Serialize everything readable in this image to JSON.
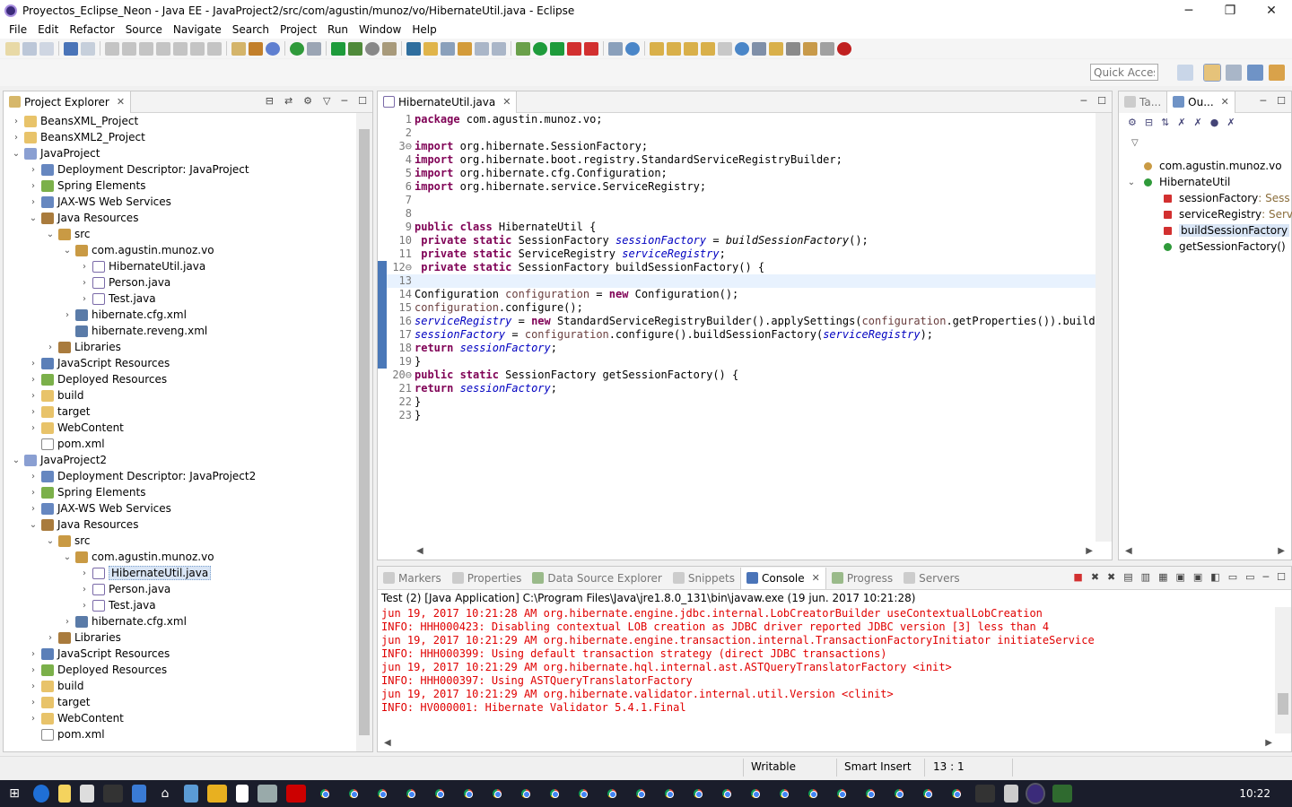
{
  "window": {
    "title": "Proyectos_Eclipse_Neon - Java EE - JavaProject2/src/com/agustin/munoz/vo/HibernateUtil.java - Eclipse"
  },
  "window_controls": {
    "minimize": "─",
    "maximize": "❐",
    "close": "✕"
  },
  "menu": [
    "File",
    "Edit",
    "Refactor",
    "Source",
    "Navigate",
    "Search",
    "Project",
    "Run",
    "Window",
    "Help"
  ],
  "quick_access": {
    "placeholder": "Quick Access"
  },
  "project_explorer": {
    "title": "Project Explorer",
    "rows": [
      {
        "label": "BeansXML_Project",
        "indent": 0,
        "tw": "›",
        "icon": "folder"
      },
      {
        "label": "BeansXML2_Project",
        "indent": 0,
        "tw": "›",
        "icon": "folder"
      },
      {
        "label": "JavaProject",
        "indent": 0,
        "tw": "⌄",
        "icon": "proj"
      },
      {
        "label": "Deployment Descriptor: JavaProject",
        "indent": 1,
        "tw": "›",
        "icon": "web"
      },
      {
        "label": "Spring Elements",
        "indent": 1,
        "tw": "›",
        "icon": "green"
      },
      {
        "label": "JAX-WS Web Services",
        "indent": 1,
        "tw": "›",
        "icon": "web"
      },
      {
        "label": "Java Resources",
        "indent": 1,
        "tw": "⌄",
        "icon": "lib"
      },
      {
        "label": "src",
        "indent": 2,
        "tw": "⌄",
        "icon": "pkg"
      },
      {
        "label": "com.agustin.munoz.vo",
        "indent": 3,
        "tw": "⌄",
        "icon": "pkg"
      },
      {
        "label": "HibernateUtil.java",
        "indent": 4,
        "tw": "›",
        "icon": "java"
      },
      {
        "label": "Person.java",
        "indent": 4,
        "tw": "›",
        "icon": "java"
      },
      {
        "label": "Test.java",
        "indent": 4,
        "tw": "›",
        "icon": "java"
      },
      {
        "label": "hibernate.cfg.xml",
        "indent": 3,
        "tw": "›",
        "icon": "xml"
      },
      {
        "label": "hibernate.reveng.xml",
        "indent": 3,
        "tw": "",
        "icon": "xml"
      },
      {
        "label": "Libraries",
        "indent": 2,
        "tw": "›",
        "icon": "lib"
      },
      {
        "label": "JavaScript Resources",
        "indent": 1,
        "tw": "›",
        "icon": "js"
      },
      {
        "label": "Deployed Resources",
        "indent": 1,
        "tw": "›",
        "icon": "green"
      },
      {
        "label": "build",
        "indent": 1,
        "tw": "›",
        "icon": "folder"
      },
      {
        "label": "target",
        "indent": 1,
        "tw": "›",
        "icon": "folder"
      },
      {
        "label": "WebContent",
        "indent": 1,
        "tw": "›",
        "icon": "folder"
      },
      {
        "label": "pom.xml",
        "indent": 1,
        "tw": "",
        "icon": "file"
      },
      {
        "label": "JavaProject2",
        "indent": 0,
        "tw": "⌄",
        "icon": "proj"
      },
      {
        "label": "Deployment Descriptor: JavaProject2",
        "indent": 1,
        "tw": "›",
        "icon": "web"
      },
      {
        "label": "Spring Elements",
        "indent": 1,
        "tw": "›",
        "icon": "green"
      },
      {
        "label": "JAX-WS Web Services",
        "indent": 1,
        "tw": "›",
        "icon": "web"
      },
      {
        "label": "Java Resources",
        "indent": 1,
        "tw": "⌄",
        "icon": "lib"
      },
      {
        "label": "src",
        "indent": 2,
        "tw": "⌄",
        "icon": "pkg"
      },
      {
        "label": "com.agustin.munoz.vo",
        "indent": 3,
        "tw": "⌄",
        "icon": "pkg"
      },
      {
        "label": "HibernateUtil.java",
        "indent": 4,
        "tw": "›",
        "icon": "java",
        "selected": true
      },
      {
        "label": "Person.java",
        "indent": 4,
        "tw": "›",
        "icon": "java"
      },
      {
        "label": "Test.java",
        "indent": 4,
        "tw": "›",
        "icon": "java"
      },
      {
        "label": "hibernate.cfg.xml",
        "indent": 3,
        "tw": "›",
        "icon": "xml"
      },
      {
        "label": "Libraries",
        "indent": 2,
        "tw": "›",
        "icon": "lib"
      },
      {
        "label": "JavaScript Resources",
        "indent": 1,
        "tw": "›",
        "icon": "js"
      },
      {
        "label": "Deployed Resources",
        "indent": 1,
        "tw": "›",
        "icon": "green"
      },
      {
        "label": "build",
        "indent": 1,
        "tw": "›",
        "icon": "folder"
      },
      {
        "label": "target",
        "indent": 1,
        "tw": "›",
        "icon": "folder"
      },
      {
        "label": "WebContent",
        "indent": 1,
        "tw": "›",
        "icon": "folder"
      },
      {
        "label": "pom.xml",
        "indent": 1,
        "tw": "",
        "icon": "file"
      }
    ]
  },
  "editor": {
    "tab": "HibernateUtil.java",
    "current_line": 13,
    "lines": [
      {
        "n": "1",
        "html": "<span class=\"kw\">package</span> com.agustin.munoz.vo;"
      },
      {
        "n": "2",
        "html": ""
      },
      {
        "n": "3⊖",
        "html": "<span class=\"kw\">import</span> org.hibernate.SessionFactory;"
      },
      {
        "n": "4",
        "html": "<span class=\"kw\">import</span> org.hibernate.boot.registry.StandardServiceRegistryBuilder;"
      },
      {
        "n": "5",
        "html": "<span class=\"kw\">import</span> org.hibernate.cfg.Configuration;"
      },
      {
        "n": "6",
        "html": "<span class=\"kw\">import</span> org.hibernate.service.ServiceRegistry;"
      },
      {
        "n": "7",
        "html": ""
      },
      {
        "n": "8",
        "html": ""
      },
      {
        "n": "9",
        "html": "<span class=\"kw\">public class</span> HibernateUtil {"
      },
      {
        "n": "10",
        "html": " <span class=\"kw\">private static</span> SessionFactory <span class=\"fld\">sessionFactory</span> = <i>buildSessionFactory</i>();"
      },
      {
        "n": "11",
        "html": " <span class=\"kw\">private static</span> ServiceRegistry <span class=\"fld\">serviceRegistry</span>;"
      },
      {
        "n": "12⊖",
        "html": " <span class=\"kw\">private static</span> SessionFactory buildSessionFactory() {"
      },
      {
        "n": "13",
        "html": ""
      },
      {
        "n": "14",
        "html": "Configuration <span class=\"lv\">configuration</span> = <span class=\"kw\">new</span> Configuration();"
      },
      {
        "n": "15",
        "html": "<span class=\"lv\">configuration</span>.configure();"
      },
      {
        "n": "16",
        "html": "<span class=\"fld\">serviceRegistry</span> = <span class=\"kw\">new</span> StandardServiceRegistryBuilder().applySettings(<span class=\"lv\">configuration</span>.getProperties()).build()"
      },
      {
        "n": "17",
        "html": "<span class=\"fld\">sessionFactory</span> = <span class=\"lv\">configuration</span>.configure().buildSessionFactory(<span class=\"fld\">serviceRegistry</span>);"
      },
      {
        "n": "18",
        "html": "<span class=\"kw\">return</span> <span class=\"fld\">sessionFactory</span>;"
      },
      {
        "n": "19",
        "html": "}"
      },
      {
        "n": "20⊖",
        "html": "<span class=\"kw\">public static</span> SessionFactory getSessionFactory() {"
      },
      {
        "n": "21",
        "html": "<span class=\"kw\">return</span> <span class=\"fld\">sessionFactory</span>;"
      },
      {
        "n": "22",
        "html": "}"
      },
      {
        "n": "23",
        "html": "}"
      }
    ]
  },
  "outline": {
    "tab_tasks": "Ta...",
    "tab_outline": "Ou...",
    "rows": [
      {
        "label": "com.agustin.munoz.vo",
        "extra": "",
        "indent": 0,
        "tw": "",
        "icon": "pkg"
      },
      {
        "label": "HibernateUtil",
        "extra": "",
        "indent": 0,
        "tw": "⌄",
        "icon": "green"
      },
      {
        "label": "sessionFactory",
        "extra": " : Sess",
        "indent": 1,
        "tw": "",
        "icon": "red"
      },
      {
        "label": "serviceRegistry",
        "extra": " : Serv",
        "indent": 1,
        "tw": "",
        "icon": "red"
      },
      {
        "label": "buildSessionFactory",
        "extra": "",
        "indent": 1,
        "tw": "",
        "icon": "red",
        "selected": true
      },
      {
        "label": "getSessionFactory()",
        "extra": "",
        "indent": 1,
        "tw": "",
        "icon": "green"
      }
    ]
  },
  "console": {
    "tabs": [
      "Markers",
      "Properties",
      "Data Source Explorer",
      "Snippets",
      "Console",
      "Progress",
      "Servers"
    ],
    "active_tab": "Console",
    "info": "Test (2) [Java Application] C:\\Program Files\\Java\\jre1.8.0_131\\bin\\javaw.exe (19 jun. 2017 10:21:28)",
    "lines": [
      "jun 19, 2017 10:21:28 AM org.hibernate.engine.jdbc.internal.LobCreatorBuilder useContextualLobCreation",
      "INFO: HHH000423: Disabling contextual LOB creation as JDBC driver reported JDBC version [3] less than 4",
      "jun 19, 2017 10:21:29 AM org.hibernate.engine.transaction.internal.TransactionFactoryInitiator initiateService",
      "INFO: HHH000399: Using default transaction strategy (direct JDBC transactions)",
      "jun 19, 2017 10:21:29 AM org.hibernate.hql.internal.ast.ASTQueryTranslatorFactory <init>",
      "INFO: HHH000397: Using ASTQueryTranslatorFactory",
      "jun 19, 2017 10:21:29 AM org.hibernate.validator.internal.util.Version <clinit>",
      "INFO: HV000001: Hibernate Validator 5.4.1.Final"
    ]
  },
  "status": {
    "writable": "Writable",
    "insert_mode": "Smart Insert",
    "position": "13 : 1"
  },
  "taskbar": {
    "time": "10:22"
  },
  "colors": {
    "console_text": "#e00000",
    "keyword": "#7f0055",
    "field": "#0000c0",
    "selection": "#d9e5f5"
  }
}
